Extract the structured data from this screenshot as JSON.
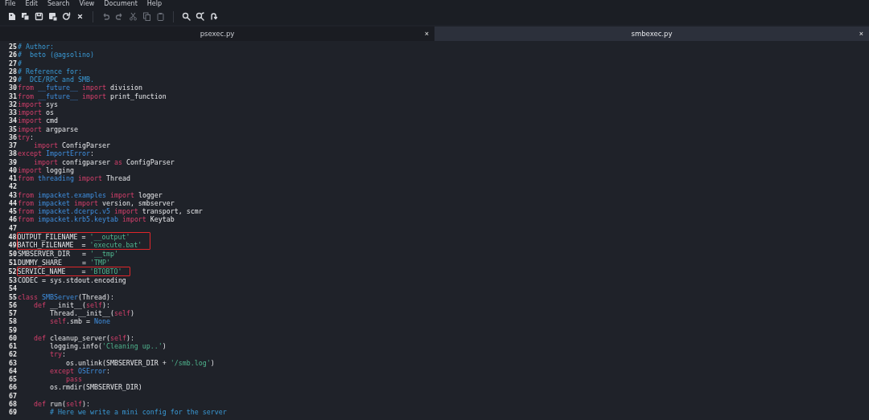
{
  "menu": [
    "File",
    "Edit",
    "Search",
    "View",
    "Document",
    "Help"
  ],
  "toolbar": [
    {
      "kind": "new"
    },
    {
      "kind": "new-template"
    },
    {
      "kind": "save"
    },
    {
      "kind": "save-as"
    },
    {
      "kind": "reload"
    },
    {
      "kind": "close"
    },
    {
      "kind": "sep"
    },
    {
      "kind": "undo"
    },
    {
      "kind": "redo"
    },
    {
      "kind": "cut"
    },
    {
      "kind": "copy"
    },
    {
      "kind": "paste"
    },
    {
      "kind": "sep"
    },
    {
      "kind": "search"
    },
    {
      "kind": "replace"
    },
    {
      "kind": "goto"
    }
  ],
  "tabs": [
    {
      "label": "psexec.py",
      "close": "×",
      "selected": false
    },
    {
      "label": "smbexec.py",
      "close": "×",
      "selected": true
    }
  ],
  "lines": [
    {
      "number": "25",
      "tokens": [
        {
          "t": "# Author:",
          "kind": "comment"
        }
      ]
    },
    {
      "number": "26",
      "tokens": [
        {
          "t": "#  beto (@agsolino)",
          "kind": "comment"
        }
      ]
    },
    {
      "number": "27",
      "tokens": [
        {
          "t": "#",
          "kind": "comment"
        }
      ]
    },
    {
      "number": "28",
      "tokens": [
        {
          "t": "# Reference for:",
          "kind": "comment"
        }
      ]
    },
    {
      "number": "29",
      "tokens": [
        {
          "t": "#  DCE/RPC and SMB.",
          "kind": "comment"
        }
      ]
    },
    {
      "number": "30",
      "tokens": [
        {
          "t": "from",
          "kind": "keyword"
        },
        {
          "t": " __future__ ",
          "kind": "module"
        },
        {
          "t": "import",
          "kind": "keyword"
        },
        {
          "t": " division",
          "kind": "plain"
        }
      ]
    },
    {
      "number": "31",
      "tokens": [
        {
          "t": "from",
          "kind": "keyword"
        },
        {
          "t": " __future__ ",
          "kind": "module"
        },
        {
          "t": "import",
          "kind": "keyword"
        },
        {
          "t": " print_function",
          "kind": "plain"
        }
      ]
    },
    {
      "number": "32",
      "tokens": [
        {
          "t": "import",
          "kind": "keyword"
        },
        {
          "t": " sys",
          "kind": "plain"
        }
      ]
    },
    {
      "number": "33",
      "tokens": [
        {
          "t": "import",
          "kind": "keyword"
        },
        {
          "t": " os",
          "kind": "plain"
        }
      ]
    },
    {
      "number": "34",
      "tokens": [
        {
          "t": "import",
          "kind": "keyword"
        },
        {
          "t": " cmd",
          "kind": "plain"
        }
      ]
    },
    {
      "number": "35",
      "tokens": [
        {
          "t": "import",
          "kind": "keyword"
        },
        {
          "t": " argparse",
          "kind": "plain"
        }
      ]
    },
    {
      "number": "36",
      "tokens": [
        {
          "t": "try",
          "kind": "keyword"
        },
        {
          "t": ":",
          "kind": "plain"
        }
      ]
    },
    {
      "number": "37",
      "tokens": [
        {
          "t": "    import",
          "kind": "keyword"
        },
        {
          "t": " ConfigParser",
          "kind": "plain"
        }
      ]
    },
    {
      "number": "38",
      "tokens": [
        {
          "t": "except",
          "kind": "keyword"
        },
        {
          "t": " ImportError",
          "kind": "module"
        },
        {
          "t": ":",
          "kind": "plain"
        }
      ]
    },
    {
      "number": "39",
      "tokens": [
        {
          "t": "    import",
          "kind": "keyword"
        },
        {
          "t": " configparser ",
          "kind": "plain"
        },
        {
          "t": "as",
          "kind": "keyword"
        },
        {
          "t": " ConfigParser",
          "kind": "plain"
        }
      ]
    },
    {
      "number": "40",
      "tokens": [
        {
          "t": "import",
          "kind": "keyword"
        },
        {
          "t": " logging",
          "kind": "plain"
        }
      ]
    },
    {
      "number": "41",
      "tokens": [
        {
          "t": "from",
          "kind": "keyword"
        },
        {
          "t": " threading ",
          "kind": "module"
        },
        {
          "t": "import",
          "kind": "keyword"
        },
        {
          "t": " Thread",
          "kind": "plain"
        }
      ]
    },
    {
      "number": "42"
    },
    {
      "number": "43",
      "tokens": [
        {
          "t": "from",
          "kind": "keyword"
        },
        {
          "t": " impacket.examples ",
          "kind": "module"
        },
        {
          "t": "import",
          "kind": "keyword"
        },
        {
          "t": " logger",
          "kind": "plain"
        }
      ]
    },
    {
      "number": "44",
      "tokens": [
        {
          "t": "from",
          "kind": "keyword"
        },
        {
          "t": " impacket ",
          "kind": "module"
        },
        {
          "t": "import",
          "kind": "keyword"
        },
        {
          "t": " version, smbserver",
          "kind": "plain"
        }
      ]
    },
    {
      "number": "45",
      "tokens": [
        {
          "t": "from",
          "kind": "keyword"
        },
        {
          "t": " impacket.dcerpc.v5 ",
          "kind": "module"
        },
        {
          "t": "import",
          "kind": "keyword"
        },
        {
          "t": " transport, scmr",
          "kind": "plain"
        }
      ]
    },
    {
      "number": "46",
      "tokens": [
        {
          "t": "from",
          "kind": "keyword"
        },
        {
          "t": " impacket.krb5.keytab ",
          "kind": "module"
        },
        {
          "t": "import",
          "kind": "keyword"
        },
        {
          "t": " Keytab",
          "kind": "plain"
        }
      ]
    },
    {
      "number": "47"
    },
    {
      "number": "48",
      "boxed": true,
      "tokens": [
        {
          "t": "OUTPUT_FILENAME = ",
          "kind": "plain"
        },
        {
          "t": "'__output'",
          "kind": "string"
        }
      ]
    },
    {
      "number": "49",
      "boxed": true,
      "tokens": [
        {
          "t": "BATCH_FILENAME  = ",
          "kind": "plain"
        },
        {
          "t": "'execute.bat'",
          "kind": "string"
        }
      ]
    },
    {
      "number": "50",
      "tokens": [
        {
          "t": "SMBSERVER_DIR   = ",
          "kind": "plain"
        },
        {
          "t": "'__tmp'",
          "kind": "string"
        }
      ]
    },
    {
      "number": "51",
      "tokens": [
        {
          "t": "DUMMY_SHARE     = ",
          "kind": "plain"
        },
        {
          "t": "'TMP'",
          "kind": "string"
        }
      ]
    },
    {
      "number": "52",
      "boxed": true,
      "tokens": [
        {
          "t": "SERVICE_NAME    = ",
          "kind": "plain"
        },
        {
          "t": "'BTOBTO'",
          "kind": "string"
        }
      ]
    },
    {
      "number": "53",
      "tokens": [
        {
          "t": "CODEC = sys.stdout.encoding",
          "kind": "plain"
        }
      ]
    },
    {
      "number": "54"
    },
    {
      "number": "55",
      "tokens": [
        {
          "t": "class",
          "kind": "keyword"
        },
        {
          "t": " SMBServer",
          "kind": "module"
        },
        {
          "t": "(Thread):",
          "kind": "plain"
        }
      ]
    },
    {
      "number": "56",
      "tokens": [
        {
          "t": "    def",
          "kind": "keyword"
        },
        {
          "t": " __init__(",
          "kind": "plain"
        },
        {
          "t": "self",
          "kind": "keyword"
        },
        {
          "t": "):",
          "kind": "plain"
        }
      ]
    },
    {
      "number": "57",
      "tokens": [
        {
          "t": "        Thread.__init__(",
          "kind": "plain"
        },
        {
          "t": "self",
          "kind": "keyword"
        },
        {
          "t": ")",
          "kind": "plain"
        }
      ]
    },
    {
      "number": "58",
      "tokens": [
        {
          "t": "        self",
          "kind": "keyword"
        },
        {
          "t": ".smb = ",
          "kind": "plain"
        },
        {
          "t": "None",
          "kind": "module"
        }
      ]
    },
    {
      "number": "59"
    },
    {
      "number": "60",
      "tokens": [
        {
          "t": "    def",
          "kind": "keyword"
        },
        {
          "t": " cleanup_server(",
          "kind": "plain"
        },
        {
          "t": "self",
          "kind": "keyword"
        },
        {
          "t": "):",
          "kind": "plain"
        }
      ]
    },
    {
      "number": "61",
      "tokens": [
        {
          "t": "        logging.info(",
          "kind": "plain"
        },
        {
          "t": "'Cleaning up..'",
          "kind": "string"
        },
        {
          "t": ")",
          "kind": "plain"
        }
      ]
    },
    {
      "number": "62",
      "tokens": [
        {
          "t": "        try",
          "kind": "keyword"
        },
        {
          "t": ":",
          "kind": "plain"
        }
      ]
    },
    {
      "number": "63",
      "tokens": [
        {
          "t": "            os.unlink(SMBSERVER_DIR + ",
          "kind": "plain"
        },
        {
          "t": "'/smb.log'",
          "kind": "string"
        },
        {
          "t": ")",
          "kind": "plain"
        }
      ]
    },
    {
      "number": "64",
      "tokens": [
        {
          "t": "        except",
          "kind": "keyword"
        },
        {
          "t": " OSError",
          "kind": "module"
        },
        {
          "t": ":",
          "kind": "plain"
        }
      ]
    },
    {
      "number": "65",
      "tokens": [
        {
          "t": "            pass",
          "kind": "keyword"
        }
      ]
    },
    {
      "number": "66",
      "tokens": [
        {
          "t": "        os.rmdir(SMBSERVER_DIR)",
          "kind": "plain"
        }
      ]
    },
    {
      "number": "67"
    },
    {
      "number": "68",
      "tokens": [
        {
          "t": "    def",
          "kind": "keyword"
        },
        {
          "t": " run(",
          "kind": "plain"
        },
        {
          "t": "self",
          "kind": "keyword"
        },
        {
          "t": "):",
          "kind": "plain"
        }
      ]
    },
    {
      "number": "69",
      "tokens": [
        {
          "t": "        # Here we write a mini config for the server",
          "kind": "comment"
        }
      ]
    }
  ]
}
